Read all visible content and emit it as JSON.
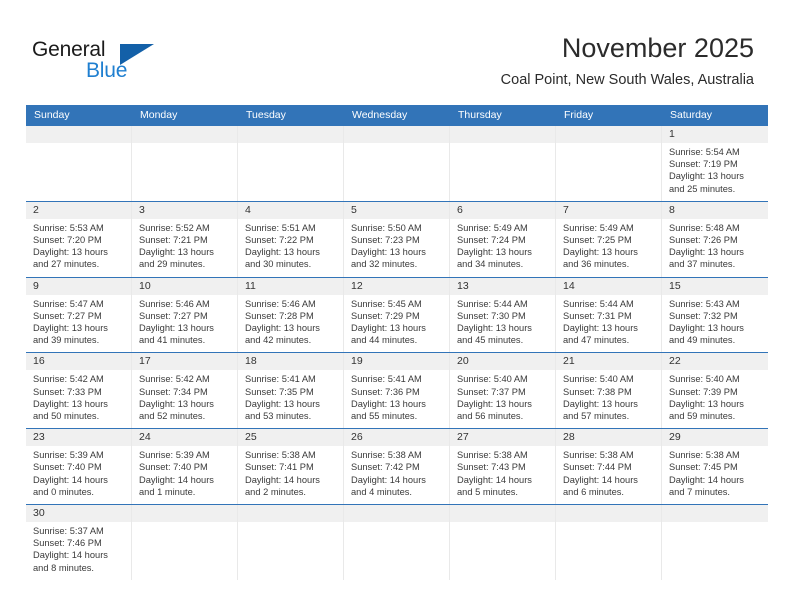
{
  "logo": {
    "primary_text": "General",
    "secondary_text": "Blue",
    "primary_color": "#1b1b1b",
    "secondary_color": "#1f7fd0",
    "triangle_color": "#1360a8"
  },
  "header": {
    "title": "November 2025",
    "subtitle": "Coal Point, New South Wales, Australia"
  },
  "theme": {
    "header_blue": "#3274b8",
    "day_strip_gray": "#f0f0f0",
    "cell_border": "#e9e9e9",
    "text_color": "#3a3a3a"
  },
  "weekdays": [
    "Sunday",
    "Monday",
    "Tuesday",
    "Wednesday",
    "Thursday",
    "Friday",
    "Saturday"
  ],
  "weeks": [
    [
      {
        "day": "",
        "empty": true
      },
      {
        "day": "",
        "empty": true
      },
      {
        "day": "",
        "empty": true
      },
      {
        "day": "",
        "empty": true
      },
      {
        "day": "",
        "empty": true
      },
      {
        "day": "",
        "empty": true
      },
      {
        "day": "1",
        "empty": false,
        "sunrise": "Sunrise: 5:54 AM",
        "sunset": "Sunset: 7:19 PM",
        "daylight": "Daylight: 13 hours and 25 minutes."
      }
    ],
    [
      {
        "day": "2",
        "empty": false,
        "sunrise": "Sunrise: 5:53 AM",
        "sunset": "Sunset: 7:20 PM",
        "daylight": "Daylight: 13 hours and 27 minutes."
      },
      {
        "day": "3",
        "empty": false,
        "sunrise": "Sunrise: 5:52 AM",
        "sunset": "Sunset: 7:21 PM",
        "daylight": "Daylight: 13 hours and 29 minutes."
      },
      {
        "day": "4",
        "empty": false,
        "sunrise": "Sunrise: 5:51 AM",
        "sunset": "Sunset: 7:22 PM",
        "daylight": "Daylight: 13 hours and 30 minutes."
      },
      {
        "day": "5",
        "empty": false,
        "sunrise": "Sunrise: 5:50 AM",
        "sunset": "Sunset: 7:23 PM",
        "daylight": "Daylight: 13 hours and 32 minutes."
      },
      {
        "day": "6",
        "empty": false,
        "sunrise": "Sunrise: 5:49 AM",
        "sunset": "Sunset: 7:24 PM",
        "daylight": "Daylight: 13 hours and 34 minutes."
      },
      {
        "day": "7",
        "empty": false,
        "sunrise": "Sunrise: 5:49 AM",
        "sunset": "Sunset: 7:25 PM",
        "daylight": "Daylight: 13 hours and 36 minutes."
      },
      {
        "day": "8",
        "empty": false,
        "sunrise": "Sunrise: 5:48 AM",
        "sunset": "Sunset: 7:26 PM",
        "daylight": "Daylight: 13 hours and 37 minutes."
      }
    ],
    [
      {
        "day": "9",
        "empty": false,
        "sunrise": "Sunrise: 5:47 AM",
        "sunset": "Sunset: 7:27 PM",
        "daylight": "Daylight: 13 hours and 39 minutes."
      },
      {
        "day": "10",
        "empty": false,
        "sunrise": "Sunrise: 5:46 AM",
        "sunset": "Sunset: 7:27 PM",
        "daylight": "Daylight: 13 hours and 41 minutes."
      },
      {
        "day": "11",
        "empty": false,
        "sunrise": "Sunrise: 5:46 AM",
        "sunset": "Sunset: 7:28 PM",
        "daylight": "Daylight: 13 hours and 42 minutes."
      },
      {
        "day": "12",
        "empty": false,
        "sunrise": "Sunrise: 5:45 AM",
        "sunset": "Sunset: 7:29 PM",
        "daylight": "Daylight: 13 hours and 44 minutes."
      },
      {
        "day": "13",
        "empty": false,
        "sunrise": "Sunrise: 5:44 AM",
        "sunset": "Sunset: 7:30 PM",
        "daylight": "Daylight: 13 hours and 45 minutes."
      },
      {
        "day": "14",
        "empty": false,
        "sunrise": "Sunrise: 5:44 AM",
        "sunset": "Sunset: 7:31 PM",
        "daylight": "Daylight: 13 hours and 47 minutes."
      },
      {
        "day": "15",
        "empty": false,
        "sunrise": "Sunrise: 5:43 AM",
        "sunset": "Sunset: 7:32 PM",
        "daylight": "Daylight: 13 hours and 49 minutes."
      }
    ],
    [
      {
        "day": "16",
        "empty": false,
        "sunrise": "Sunrise: 5:42 AM",
        "sunset": "Sunset: 7:33 PM",
        "daylight": "Daylight: 13 hours and 50 minutes."
      },
      {
        "day": "17",
        "empty": false,
        "sunrise": "Sunrise: 5:42 AM",
        "sunset": "Sunset: 7:34 PM",
        "daylight": "Daylight: 13 hours and 52 minutes."
      },
      {
        "day": "18",
        "empty": false,
        "sunrise": "Sunrise: 5:41 AM",
        "sunset": "Sunset: 7:35 PM",
        "daylight": "Daylight: 13 hours and 53 minutes."
      },
      {
        "day": "19",
        "empty": false,
        "sunrise": "Sunrise: 5:41 AM",
        "sunset": "Sunset: 7:36 PM",
        "daylight": "Daylight: 13 hours and 55 minutes."
      },
      {
        "day": "20",
        "empty": false,
        "sunrise": "Sunrise: 5:40 AM",
        "sunset": "Sunset: 7:37 PM",
        "daylight": "Daylight: 13 hours and 56 minutes."
      },
      {
        "day": "21",
        "empty": false,
        "sunrise": "Sunrise: 5:40 AM",
        "sunset": "Sunset: 7:38 PM",
        "daylight": "Daylight: 13 hours and 57 minutes."
      },
      {
        "day": "22",
        "empty": false,
        "sunrise": "Sunrise: 5:40 AM",
        "sunset": "Sunset: 7:39 PM",
        "daylight": "Daylight: 13 hours and 59 minutes."
      }
    ],
    [
      {
        "day": "23",
        "empty": false,
        "sunrise": "Sunrise: 5:39 AM",
        "sunset": "Sunset: 7:40 PM",
        "daylight": "Daylight: 14 hours and 0 minutes."
      },
      {
        "day": "24",
        "empty": false,
        "sunrise": "Sunrise: 5:39 AM",
        "sunset": "Sunset: 7:40 PM",
        "daylight": "Daylight: 14 hours and 1 minute."
      },
      {
        "day": "25",
        "empty": false,
        "sunrise": "Sunrise: 5:38 AM",
        "sunset": "Sunset: 7:41 PM",
        "daylight": "Daylight: 14 hours and 2 minutes."
      },
      {
        "day": "26",
        "empty": false,
        "sunrise": "Sunrise: 5:38 AM",
        "sunset": "Sunset: 7:42 PM",
        "daylight": "Daylight: 14 hours and 4 minutes."
      },
      {
        "day": "27",
        "empty": false,
        "sunrise": "Sunrise: 5:38 AM",
        "sunset": "Sunset: 7:43 PM",
        "daylight": "Daylight: 14 hours and 5 minutes."
      },
      {
        "day": "28",
        "empty": false,
        "sunrise": "Sunrise: 5:38 AM",
        "sunset": "Sunset: 7:44 PM",
        "daylight": "Daylight: 14 hours and 6 minutes."
      },
      {
        "day": "29",
        "empty": false,
        "sunrise": "Sunrise: 5:38 AM",
        "sunset": "Sunset: 7:45 PM",
        "daylight": "Daylight: 14 hours and 7 minutes."
      }
    ],
    [
      {
        "day": "30",
        "empty": false,
        "sunrise": "Sunrise: 5:37 AM",
        "sunset": "Sunset: 7:46 PM",
        "daylight": "Daylight: 14 hours and 8 minutes."
      },
      {
        "day": "",
        "empty": true
      },
      {
        "day": "",
        "empty": true
      },
      {
        "day": "",
        "empty": true
      },
      {
        "day": "",
        "empty": true
      },
      {
        "day": "",
        "empty": true
      },
      {
        "day": "",
        "empty": true
      }
    ]
  ]
}
